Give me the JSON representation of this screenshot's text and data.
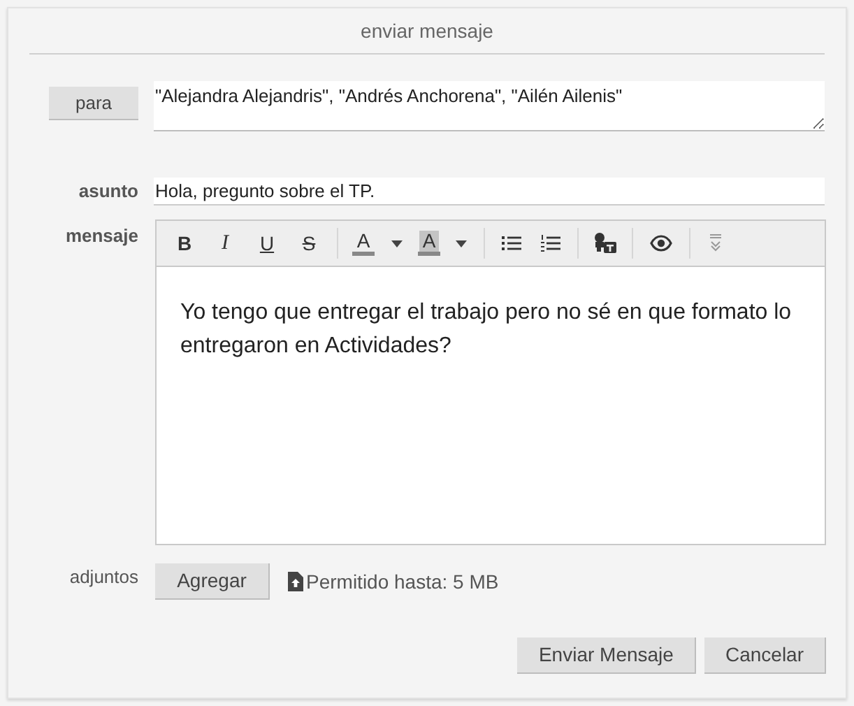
{
  "title": "enviar mensaje",
  "to": {
    "button": "para",
    "value": "\"Alejandra Alejandris\", \"Andrés Anchorena\", \"Ailén Ailenis\""
  },
  "subject": {
    "label": "asunto",
    "value": "Hola, pregunto sobre el TP."
  },
  "message": {
    "label": "mensaje",
    "body": "Yo tengo que entregar el trabajo pero no sé en que formato lo entregaron en Actividades?",
    "toolbar": [
      {
        "kind": "bold",
        "label": "B"
      },
      {
        "kind": "italic",
        "label": "I"
      },
      {
        "kind": "underline",
        "label": "U"
      },
      {
        "kind": "strike",
        "label": "S"
      },
      {
        "kind": "separator"
      },
      {
        "kind": "font-color",
        "label": "A"
      },
      {
        "kind": "dropdown"
      },
      {
        "kind": "highlight",
        "label": "A"
      },
      {
        "kind": "dropdown"
      },
      {
        "kind": "separator"
      },
      {
        "kind": "bullets"
      },
      {
        "kind": "numbers"
      },
      {
        "kind": "separator"
      },
      {
        "kind": "speak"
      },
      {
        "kind": "separator"
      },
      {
        "kind": "preview"
      },
      {
        "kind": "separator"
      },
      {
        "kind": "more"
      }
    ]
  },
  "attachments": {
    "label": "adjuntos",
    "button": "Agregar",
    "note": "Permitido hasta: 5 MB"
  },
  "buttons": [
    "Enviar Mensaje",
    "Cancelar"
  ]
}
